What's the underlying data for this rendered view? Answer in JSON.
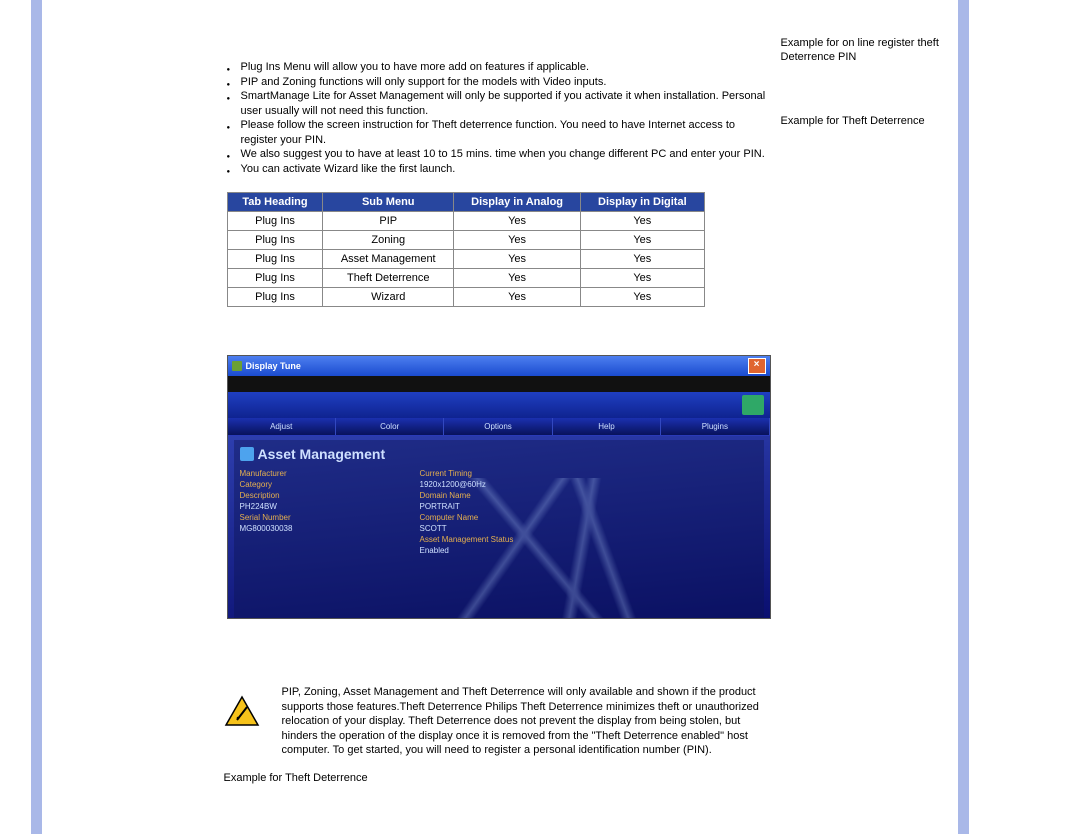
{
  "right_sidebar": {
    "line1": "Example for on line register theft",
    "line2": "Deterrence PIN",
    "line3": "Example for Theft Deterrence"
  },
  "bullets": [
    "Plug Ins Menu will allow you to have more add on features if applicable.",
    "PIP and Zoning functions will only support for the models with Video inputs.",
    "SmartManage Lite for Asset Management will only be supported if you activate it when installation. Personal user usually will not need this function.",
    "Please follow the screen instruction for Theft deterrence function. You need to have Internet access to register your PIN.",
    "We also suggest you to have at least 10 to 15 mins. time when you change different PC and enter your PIN.",
    "You can activate Wizard like the first launch."
  ],
  "table": {
    "headers": [
      "Tab Heading",
      "Sub Menu",
      "Display in Analog",
      "Display in Digital"
    ],
    "rows": [
      [
        "Plug Ins",
        "PIP",
        "Yes",
        "Yes"
      ],
      [
        "Plug Ins",
        "Zoning",
        "Yes",
        "Yes"
      ],
      [
        "Plug Ins",
        "Asset Management",
        "Yes",
        "Yes"
      ],
      [
        "Plug Ins",
        "Theft Deterrence",
        "Yes",
        "Yes"
      ],
      [
        "Plug Ins",
        "Wizard",
        "Yes",
        "Yes"
      ]
    ]
  },
  "screenshot": {
    "window_title": "Display Tune",
    "tabs": [
      "Adjust",
      "Color",
      "Options",
      "Help",
      "Plugins"
    ],
    "panel_heading": "Asset Management",
    "left_fields": {
      "f1_label": "Manufacturer",
      "f1_value": "",
      "f2_label": "Category",
      "f2_value": "",
      "f3_label": "Description",
      "f3_value": "PH224BW",
      "f4_label": "Serial Number",
      "f4_value": "MG800030038"
    },
    "right_fields": {
      "f1_label": "Current Timing",
      "f1_value": "1920x1200@60Hz",
      "f2_label": "Domain Name",
      "f2_value": "PORTRAIT",
      "f3_label": "Computer Name",
      "f3_value": "SCOTT",
      "f4_label": "Asset Management Status",
      "f4_value": "Enabled"
    }
  },
  "warning_text": "PIP, Zoning, Asset Management and Theft Deterrence will only available and shown if the product supports those features.Theft Deterrence Philips Theft Deterrence minimizes theft or unauthorized relocation of your display. Theft Deterrence does not prevent the display from being stolen, but hinders the operation of the display once it is removed from the \"Theft Deterrence enabled\" host computer. To get started, you will need to register a personal identification number (PIN).",
  "bottom_text": "Example for Theft Deterrence"
}
